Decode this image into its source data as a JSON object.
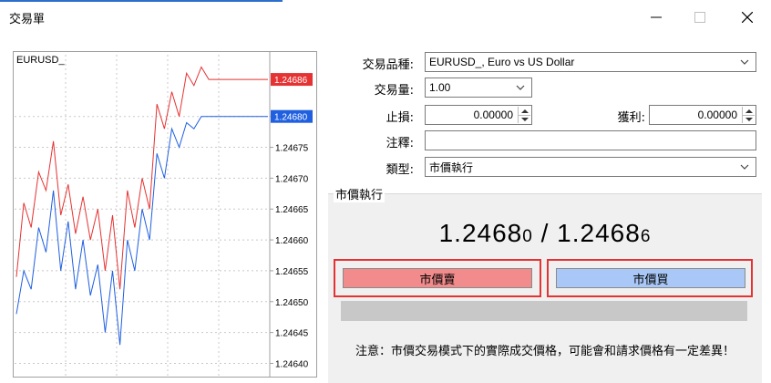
{
  "window": {
    "title": "交易單",
    "minimize_symbol": "—",
    "maximize_symbol": "☐",
    "close_symbol": "✕"
  },
  "chart": {
    "symbol": "EURUSD_",
    "price_ticks": [
      "1.24680",
      "1.24675",
      "1.24670",
      "1.24665",
      "1.24660",
      "1.24655",
      "1.24650",
      "1.24645",
      "1.24640"
    ],
    "ask_label": "1.24686",
    "bid_label": "1.24680",
    "ask_color": "#e53232",
    "bid_color": "#1f5fe0"
  },
  "chart_data": {
    "type": "line",
    "ylim": [
      1.24638,
      1.2469
    ],
    "y_ticks": [
      1.2468,
      1.24675,
      1.2467,
      1.24665,
      1.2466,
      1.24655,
      1.2465,
      1.24645,
      1.2464
    ],
    "series": [
      {
        "values": [
          1.24654,
          1.24666,
          1.24662,
          1.24671,
          1.24668,
          1.24676,
          1.24664,
          1.24669,
          1.24661,
          1.24667,
          1.2466,
          1.24665,
          1.24655,
          1.24664,
          1.24652,
          1.24668,
          1.24662,
          1.2467,
          1.24665,
          1.24682,
          1.24678,
          1.24684,
          1.2468,
          1.24687,
          1.24685,
          1.24688,
          1.24686,
          1.24686,
          1.24686,
          1.24686,
          1.24686,
          1.24686,
          1.24686,
          1.24686,
          1.24686
        ]
      },
      {
        "values": [
          1.24648,
          1.24655,
          1.24652,
          1.24662,
          1.24658,
          1.24668,
          1.24655,
          1.24663,
          1.24652,
          1.2466,
          1.24651,
          1.24656,
          1.24645,
          1.24655,
          1.24643,
          1.2466,
          1.24655,
          1.24665,
          1.2466,
          1.24674,
          1.2467,
          1.24678,
          1.24675,
          1.24679,
          1.24678,
          1.2468,
          1.2468,
          1.2468,
          1.2468,
          1.2468,
          1.2468,
          1.2468,
          1.2468,
          1.2468,
          1.2468
        ]
      }
    ]
  },
  "form": {
    "symbol_label": "交易品種:",
    "symbol_value": "EURUSD_, Euro vs US Dollar",
    "volume_label": "交易量:",
    "volume_value": "1.00",
    "sl_label": "止損:",
    "sl_value": "0.00000",
    "tp_label": "獲利:",
    "tp_value": "0.00000",
    "comment_label": "注釋:",
    "comment_value": "",
    "type_label": "類型:",
    "type_value": "市價執行"
  },
  "execution": {
    "group_title": "市價執行",
    "bid_main": "1.2468",
    "bid_last": "0",
    "separator": " / ",
    "ask_main": "1.2468",
    "ask_last": "6",
    "sell_label": "市價賣",
    "buy_label": "市價買",
    "note": "注意：市價交易模式下的實際成交價格，可能會和請求價格有一定差異！"
  }
}
